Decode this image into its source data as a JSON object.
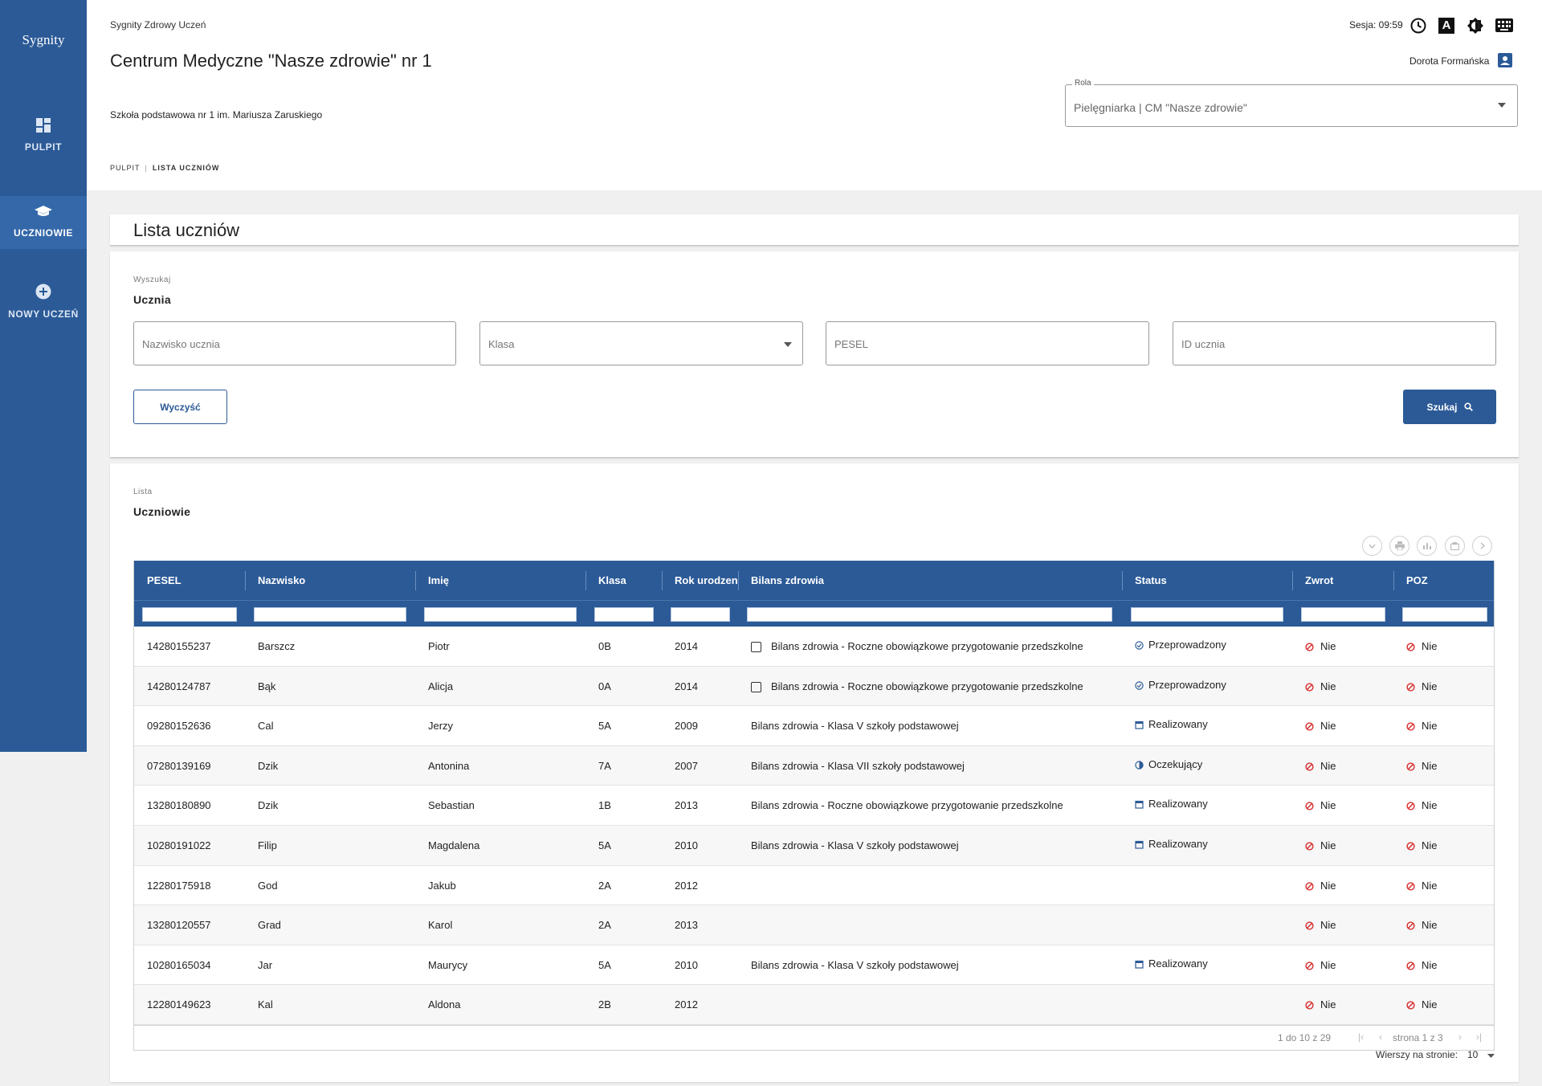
{
  "sidebar": {
    "logo": "Sygnity",
    "items": [
      {
        "label": "PULPIT",
        "icon": "dashboard-icon",
        "active": false
      },
      {
        "label": "UCZNIOWIE",
        "icon": "graduation-cap-icon",
        "active": true
      },
      {
        "label": "NOWY UCZEŃ",
        "icon": "add-circle-icon",
        "active": false
      }
    ]
  },
  "header": {
    "app_name": "Sygnity Zdrowy Uczeń",
    "center_name": "Centrum Medyczne \"Nasze zdrowie\" nr 1",
    "school_name": "Szkoła podstawowa nr 1 im. Mariusza Zaruskiego",
    "session_label": "Sesja: 09:59",
    "user_name": "Dorota Formańska",
    "role_label": "Rola",
    "role_value": "Pielęgniarka | CM \"Nasze zdrowie\"",
    "breadcrumb": [
      "PULPIT",
      "LISTA UCZNIÓW"
    ]
  },
  "page": {
    "title": "Lista uczniów"
  },
  "search": {
    "caption": "Wyszukaj",
    "heading": "Ucznia",
    "fields": {
      "surname_placeholder": "Nazwisko ucznia",
      "class_placeholder": "Klasa",
      "pesel_placeholder": "PESEL",
      "id_placeholder": "ID ucznia"
    },
    "clear_label": "Wyczyść",
    "search_label": "Szukaj"
  },
  "list": {
    "caption": "Lista",
    "heading": "Uczniowie",
    "columns": [
      "PESEL",
      "Nazwisko",
      "Imię",
      "Klasa",
      "Rok urodzenia",
      "Bilans zdrowia",
      "Status",
      "Zwrot",
      "POZ"
    ],
    "rows": [
      {
        "pesel": "14280155237",
        "surname": "Barszcz",
        "name": "Piotr",
        "class": "0B",
        "year": "2014",
        "bilans": "Bilans zdrowia - Roczne obowiązkowe przygotowanie przedszkolne",
        "checkbox": true,
        "status": "Przeprowadzony",
        "status_icon": "check-circle",
        "zwrot": "Nie",
        "poz": "Nie"
      },
      {
        "pesel": "14280124787",
        "surname": "Bąk",
        "name": "Alicja",
        "class": "0A",
        "year": "2014",
        "bilans": "Bilans zdrowia - Roczne obowiązkowe przygotowanie przedszkolne",
        "checkbox": true,
        "status": "Przeprowadzony",
        "status_icon": "check-circle",
        "zwrot": "Nie",
        "poz": "Nie"
      },
      {
        "pesel": "09280152636",
        "surname": "Cal",
        "name": "Jerzy",
        "class": "5A",
        "year": "2009",
        "bilans": "Bilans zdrowia - Klasa V szkoły podstawowej",
        "checkbox": false,
        "status": "Realizowany",
        "status_icon": "calendar",
        "zwrot": "Nie",
        "poz": "Nie"
      },
      {
        "pesel": "07280139169",
        "surname": "Dzik",
        "name": "Antonina",
        "class": "7A",
        "year": "2007",
        "bilans": "Bilans zdrowia - Klasa VII szkoły podstawowej",
        "checkbox": false,
        "status": "Oczekujący",
        "status_icon": "half-circle",
        "zwrot": "Nie",
        "poz": "Nie"
      },
      {
        "pesel": "13280180890",
        "surname": "Dzik",
        "name": "Sebastian",
        "class": "1B",
        "year": "2013",
        "bilans": "Bilans zdrowia - Roczne obowiązkowe przygotowanie przedszkolne",
        "checkbox": false,
        "status": "Realizowany",
        "status_icon": "calendar",
        "zwrot": "Nie",
        "poz": "Nie"
      },
      {
        "pesel": "10280191022",
        "surname": "Filip",
        "name": "Magdalena",
        "class": "5A",
        "year": "2010",
        "bilans": "Bilans zdrowia - Klasa V szkoły podstawowej",
        "checkbox": false,
        "status": "Realizowany",
        "status_icon": "calendar",
        "zwrot": "Nie",
        "poz": "Nie"
      },
      {
        "pesel": "12280175918",
        "surname": "God",
        "name": "Jakub",
        "class": "2A",
        "year": "2012",
        "bilans": "",
        "checkbox": false,
        "status": "",
        "status_icon": "",
        "zwrot": "Nie",
        "poz": "Nie"
      },
      {
        "pesel": "13280120557",
        "surname": "Grad",
        "name": "Karol",
        "class": "2A",
        "year": "2013",
        "bilans": "",
        "checkbox": false,
        "status": "",
        "status_icon": "",
        "zwrot": "Nie",
        "poz": "Nie"
      },
      {
        "pesel": "10280165034",
        "surname": "Jar",
        "name": "Maurycy",
        "class": "5A",
        "year": "2010",
        "bilans": "Bilans zdrowia - Klasa V szkoły podstawowej",
        "checkbox": false,
        "status": "Realizowany",
        "status_icon": "calendar",
        "zwrot": "Nie",
        "poz": "Nie"
      },
      {
        "pesel": "12280149623",
        "surname": "Kal",
        "name": "Aldona",
        "class": "2B",
        "year": "2012",
        "bilans": "",
        "checkbox": false,
        "status": "",
        "status_icon": "",
        "zwrot": "Nie",
        "poz": "Nie"
      }
    ],
    "range_label": "1 do 10 z 29",
    "page_label": "strona 1 z 3",
    "rows_per_page_label": "Wierszy na stronie:",
    "rows_per_page_value": "10"
  },
  "colors": {
    "primary": "#2b5a97",
    "sidebar_active": "#3468a9",
    "ok_icon": "#2b5a97",
    "no_icon": "#d62b2b"
  }
}
